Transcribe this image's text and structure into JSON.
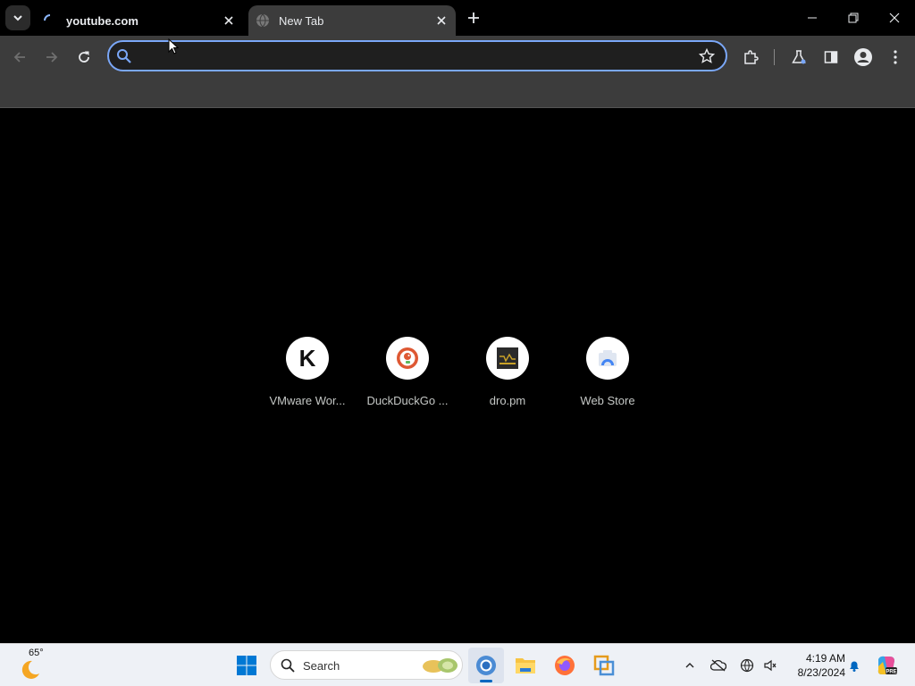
{
  "browser": {
    "tabs": [
      {
        "title": "youtube.com",
        "state": "loading",
        "active": false
      },
      {
        "title": "New Tab",
        "state": "loaded",
        "active": true
      }
    ],
    "omnibox": {
      "value": "",
      "placeholder": ""
    }
  },
  "shortcuts": [
    {
      "label": "VMware Wor...",
      "icon": "letter-k-icon",
      "letter": "K"
    },
    {
      "label": "DuckDuckGo ...",
      "icon": "duckduckgo-icon"
    },
    {
      "label": "dro.pm",
      "icon": "dro-pm-icon"
    },
    {
      "label": "Web Store",
      "icon": "web-store-icon"
    }
  ],
  "taskbar": {
    "weather": {
      "temp": "65°"
    },
    "search_label": "Search",
    "clock": {
      "time": "4:19 AM",
      "date": "8/23/2024"
    }
  },
  "colors": {
    "accent": "#7aa7f7",
    "taskbar_bg": "#eef1f6",
    "windows_blue": "#0078d4"
  }
}
